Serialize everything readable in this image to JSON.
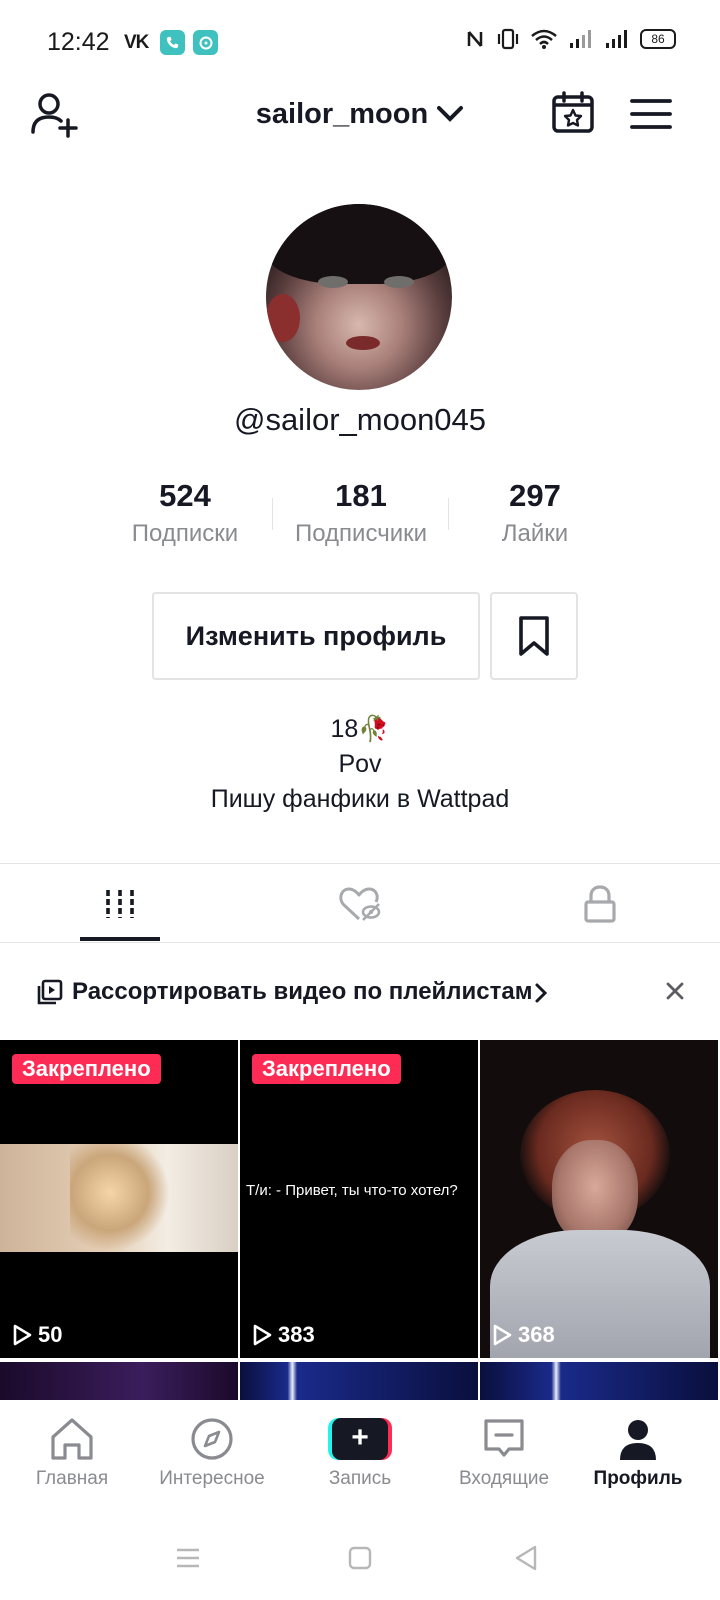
{
  "status_bar": {
    "time": "12:42",
    "left_icons": [
      "vk-icon",
      "phone-app-icon",
      "chat-app-icon"
    ],
    "vk_text": "VK",
    "right_icons": [
      "nfc-icon",
      "vibrate-icon",
      "wifi-icon",
      "signal-icon",
      "signal-icon"
    ],
    "battery": "86"
  },
  "top_nav": {
    "username": "sailor_moon",
    "left_icon": "add-user-icon",
    "right_icons": [
      "calendar-star-icon",
      "menu-icon"
    ]
  },
  "profile": {
    "handle": "@sailor_moon045",
    "stats": [
      {
        "value": "524",
        "label": "Подписки"
      },
      {
        "value": "181",
        "label": "Подписчики"
      },
      {
        "value": "297",
        "label": "Лайки"
      }
    ],
    "edit_button": "Изменить профиль",
    "bio": [
      "18🥀",
      "Pov",
      "Пишу фанфики в Wattpad"
    ]
  },
  "tabs": [
    {
      "icon": "grid-icon",
      "active": true
    },
    {
      "icon": "liked-hidden-icon",
      "active": false
    },
    {
      "icon": "lock-icon",
      "active": false
    }
  ],
  "playlist_banner": {
    "text": "Рассортировать видео по плейлистам"
  },
  "videos": [
    {
      "pinned_label": "Закреплено",
      "views": "50"
    },
    {
      "pinned_label": "Закреплено",
      "views": "383",
      "caption": "Т/и: - Привет, ты что-то хотел?"
    },
    {
      "pinned_label": "",
      "views": "368"
    }
  ],
  "bottom_nav": [
    {
      "label": "Главная",
      "icon": "home-icon"
    },
    {
      "label": "Интересное",
      "icon": "compass-icon"
    },
    {
      "label": "Запись",
      "icon": "plus-icon"
    },
    {
      "label": "Входящие",
      "icon": "inbox-icon"
    },
    {
      "label": "Профиль",
      "icon": "profile-icon",
      "active": true
    }
  ],
  "colors": {
    "accent": "#fe2c55",
    "cyan": "#25f4ee",
    "text": "#161823",
    "muted": "#8a8b91",
    "divider": "#e3e3e4"
  }
}
